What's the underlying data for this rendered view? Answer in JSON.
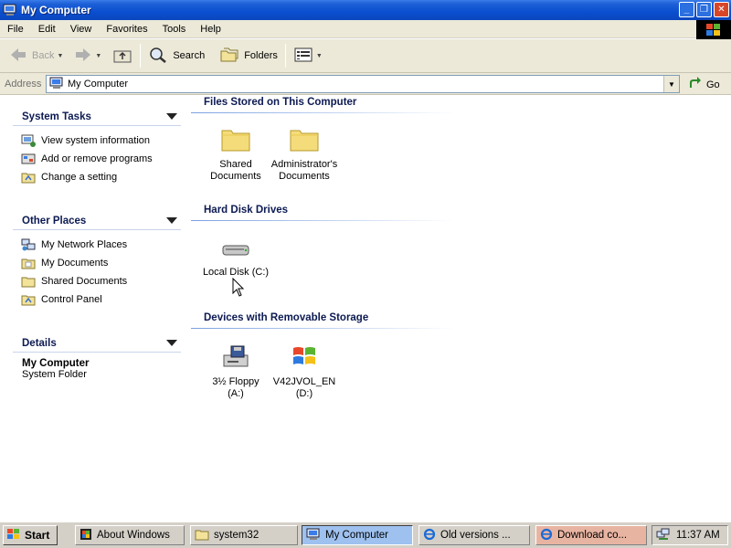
{
  "window": {
    "title": "My Computer"
  },
  "menu": [
    "File",
    "Edit",
    "View",
    "Favorites",
    "Tools",
    "Help"
  ],
  "toolbar": {
    "back": "Back",
    "search": "Search",
    "folders": "Folders"
  },
  "address": {
    "label": "Address",
    "value": "My Computer",
    "go": "Go"
  },
  "sidebar": {
    "system_tasks": {
      "title": "System Tasks",
      "items": [
        "View system information",
        "Add or remove programs",
        "Change a setting"
      ]
    },
    "other_places": {
      "title": "Other Places",
      "items": [
        "My Network Places",
        "My Documents",
        "Shared Documents",
        "Control Panel"
      ]
    },
    "details": {
      "title": "Details",
      "name": "My Computer",
      "type": "System Folder"
    }
  },
  "groups": {
    "files_stored": {
      "title": "Files Stored on This Computer",
      "items": [
        {
          "line1": "Shared",
          "line2": "Documents"
        },
        {
          "line1": "Administrator's",
          "line2": "Documents"
        }
      ]
    },
    "hard_disks": {
      "title": "Hard Disk Drives",
      "items": [
        {
          "line1": "Local Disk (C:)"
        }
      ]
    },
    "removable": {
      "title": "Devices with Removable Storage",
      "items": [
        {
          "line1": "3½ Floppy",
          "line2": "(A:)"
        },
        {
          "line1": "V42JVOL_EN",
          "line2": "(D:)"
        }
      ]
    }
  },
  "taskbar": {
    "start": "Start",
    "buttons": [
      "About Windows",
      "system32",
      "My Computer",
      "Old versions ...",
      "Download co..."
    ],
    "clock": "11:37 AM"
  }
}
